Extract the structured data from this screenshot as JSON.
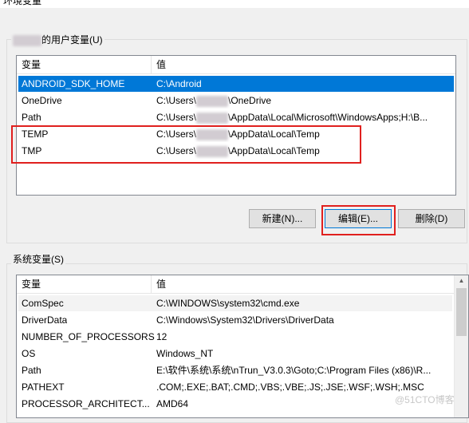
{
  "window": {
    "title": "环境变量"
  },
  "user_group": {
    "legend": "的用户变量(U)",
    "columns": [
      "变量",
      "值"
    ],
    "rows": [
      {
        "name": "ANDROID_SDK_HOME",
        "value_prefix": "C:\\Android",
        "value_suffix": "",
        "selected": true
      },
      {
        "name": "OneDrive",
        "value_prefix": "C:\\Users\\",
        "value_suffix": "\\OneDrive",
        "selected": false
      },
      {
        "name": "Path",
        "value_prefix": "C:\\Users\\",
        "value_suffix": "\\AppData\\Local\\Microsoft\\WindowsApps;H:\\B...",
        "selected": false
      },
      {
        "name": "TEMP",
        "value_prefix": "C:\\Users\\",
        "value_suffix": "\\AppData\\Local\\Temp",
        "selected": false
      },
      {
        "name": "TMP",
        "value_prefix": "C:\\Users\\",
        "value_suffix": "\\AppData\\Local\\Temp",
        "selected": false
      }
    ],
    "buttons": {
      "new": "新建(N)...",
      "edit": "编辑(E)...",
      "delete": "删除(D)"
    }
  },
  "system_group": {
    "legend": "系统变量(S)",
    "columns": [
      "变量",
      "值"
    ],
    "rows": [
      {
        "name": "ComSpec",
        "value": "C:\\WINDOWS\\system32\\cmd.exe"
      },
      {
        "name": "DriverData",
        "value": "C:\\Windows\\System32\\Drivers\\DriverData"
      },
      {
        "name": "NUMBER_OF_PROCESSORS",
        "value": "12"
      },
      {
        "name": "OS",
        "value": "Windows_NT"
      },
      {
        "name": "Path",
        "value": "E:\\软件\\系统\\系统\\nTrun_V3.0.3\\Goto;C:\\Program Files (x86)\\R..."
      },
      {
        "name": "PATHEXT",
        "value": ".COM;.EXE;.BAT;.CMD;.VBS;.VBE;.JS;.JSE;.WSF;.WSH;.MSC"
      },
      {
        "name": "PROCESSOR_ARCHITECT...",
        "value": "AMD64"
      }
    ]
  },
  "watermark": "@51CTO博客",
  "colors": {
    "selection": "#0078d7",
    "highlight_box": "#e0201e"
  }
}
